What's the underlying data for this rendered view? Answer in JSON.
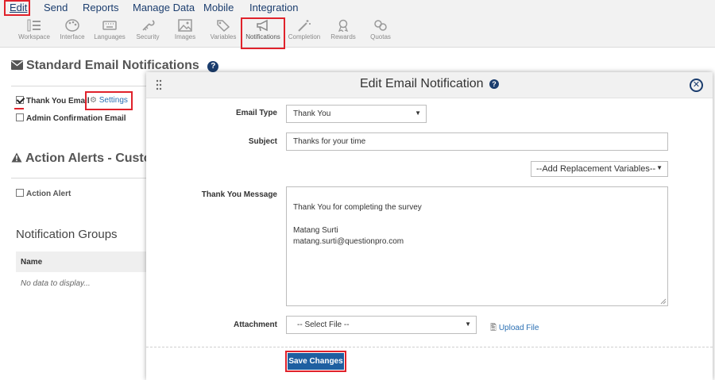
{
  "menu": [
    "Edit",
    "Send",
    "Reports",
    "Manage Data",
    "Mobile",
    "Integration"
  ],
  "toolbar": [
    {
      "label": "Workspace",
      "icon": "workspace-icon"
    },
    {
      "label": "Interface",
      "icon": "palette-icon"
    },
    {
      "label": "Languages",
      "icon": "keyboard-icon"
    },
    {
      "label": "Security",
      "icon": "lock-icon"
    },
    {
      "label": "Images",
      "icon": "image-icon"
    },
    {
      "label": "Variables",
      "icon": "tag-icon"
    },
    {
      "label": "Notifications",
      "icon": "megaphone-icon"
    },
    {
      "label": "Completion",
      "icon": "magic-wand-icon"
    },
    {
      "label": "Rewards",
      "icon": "rewards-icon"
    },
    {
      "label": "Quotas",
      "icon": "quotas-icon"
    }
  ],
  "page": {
    "standard_title": "Standard Email Notifications",
    "thank_you_email": "Thank You Email",
    "settings": "Settings",
    "admin_email": "Admin Confirmation Email",
    "alerts_title": "Action Alerts - Custom E",
    "action_alert": "Action Alert",
    "groups_title": "Notification Groups",
    "name_col": "Name",
    "no_data": "No data to display..."
  },
  "modal": {
    "title": "Edit Email Notification",
    "email_type_label": "Email Type",
    "email_type_value": "Thank You",
    "subject_label": "Subject",
    "subject_value": "Thanks for your time",
    "replacement": "--Add Replacement Variables--",
    "message_label": "Thank You Message",
    "message_value": "Thank You for completing the survey\n\nMatang Surti\nmatang.surti@questionpro.com",
    "attachment_label": "Attachment",
    "attachment_value": "-- Select File --",
    "upload": "Upload File",
    "save": "Save Changes"
  },
  "colors": {
    "accent": "#1b3d6e",
    "highlight": "#e0222b",
    "button": "#1e5fa1"
  }
}
